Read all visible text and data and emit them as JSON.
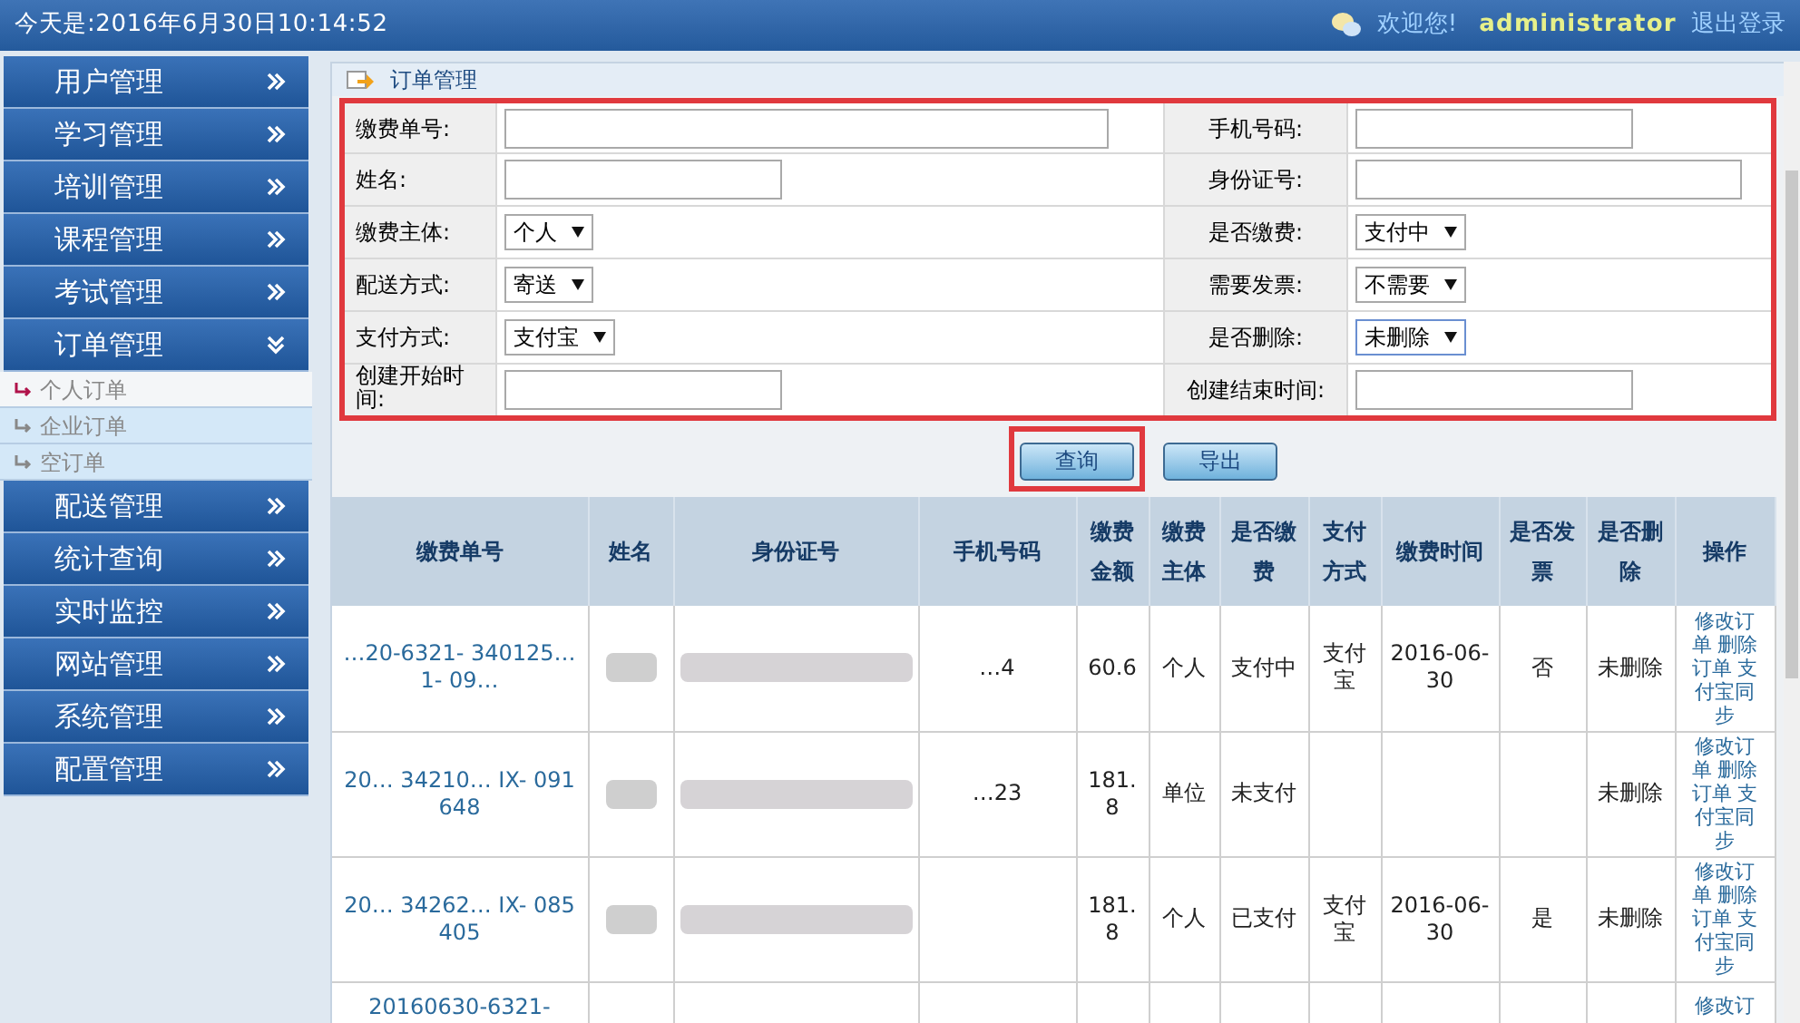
{
  "header": {
    "datetime": "今天是:2016年6月30日10:14:52",
    "welcome": "欢迎您!",
    "username": "administrator",
    "logout": "退出登录"
  },
  "sidebar": {
    "items": [
      {
        "label": "用户管理",
        "expanded": false
      },
      {
        "label": "学习管理",
        "expanded": false
      },
      {
        "label": "培训管理",
        "expanded": false
      },
      {
        "label": "课程管理",
        "expanded": false
      },
      {
        "label": "考试管理",
        "expanded": false
      },
      {
        "label": "订单管理",
        "expanded": true,
        "children": [
          {
            "label": "个人订单",
            "selected": true
          },
          {
            "label": "企业订单",
            "selected": false
          },
          {
            "label": "空订单",
            "selected": false
          }
        ]
      },
      {
        "label": "配送管理",
        "expanded": false
      },
      {
        "label": "统计查询",
        "expanded": false
      },
      {
        "label": "实时监控",
        "expanded": false
      },
      {
        "label": "网站管理",
        "expanded": false
      },
      {
        "label": "系统管理",
        "expanded": false
      },
      {
        "label": "配置管理",
        "expanded": false
      }
    ]
  },
  "panel": {
    "title": "订单管理"
  },
  "form": {
    "rows": [
      [
        {
          "label": "缴费单号:",
          "kind": "text",
          "wide": true
        },
        {
          "label": "手机号码:",
          "kind": "text",
          "wide": false
        }
      ],
      [
        {
          "label": "姓名:",
          "kind": "text",
          "wide": false
        },
        {
          "label": "身份证号:",
          "kind": "text",
          "wide": true
        }
      ],
      [
        {
          "label": "缴费主体:",
          "kind": "select",
          "value": "个人"
        },
        {
          "label": "是否缴费:",
          "kind": "select",
          "value": "支付中"
        }
      ],
      [
        {
          "label": "配送方式:",
          "kind": "select",
          "value": "寄送"
        },
        {
          "label": "需要发票:",
          "kind": "select",
          "value": "不需要"
        }
      ],
      [
        {
          "label": "支付方式:",
          "kind": "select",
          "value": "支付宝"
        },
        {
          "label": "是否删除:",
          "kind": "select",
          "value": "未删除",
          "focused": true
        }
      ],
      [
        {
          "label": "创建开始时间:",
          "kind": "text",
          "wide": false
        },
        {
          "label": "创建结束时间:",
          "kind": "text",
          "wide": false
        }
      ]
    ]
  },
  "buttons": [
    {
      "label": "查询",
      "highlighted": true
    },
    {
      "label": "导出",
      "highlighted": false
    }
  ],
  "table": {
    "columns": [
      "缴费单号",
      "姓名",
      "身份证号",
      "手机号码",
      "缴费金额",
      "缴费主体",
      "是否缴费",
      "支付方式",
      "缴费时间",
      "是否发票",
      "是否删除",
      "操作"
    ],
    "rows": [
      {
        "order_no": "…20-6321- 340125… 1- 09…",
        "name_redacted": true,
        "id_redacted": true,
        "phone": "…4",
        "amount": "60.6",
        "payer": "个人",
        "paid": "支付中",
        "method": "支付宝",
        "time": "2016-06-30",
        "invoice": "否",
        "deleted": "未删除",
        "action": "修改订单 删除订单 支付宝同步"
      },
      {
        "order_no": "20… 34210… IX- 091648",
        "name_redacted": true,
        "id_redacted": true,
        "phone": "…23",
        "amount": "181.8",
        "payer": "单位",
        "paid": "未支付",
        "method": "",
        "time": "",
        "invoice": "",
        "deleted": "未删除",
        "action": "修改订单 删除订单 支付宝同步"
      },
      {
        "order_no": "20… 34262… IX- 085405",
        "name_redacted": true,
        "id_redacted": true,
        "phone": "",
        "amount": "181.8",
        "payer": "个人",
        "paid": "已支付",
        "method": "支付宝",
        "time": "2016-06-30",
        "invoice": "是",
        "deleted": "未删除",
        "action": "修改订单 删除订单 支付宝同步"
      },
      {
        "order_no": "20160630-6321-",
        "phone": "",
        "amount": "",
        "payer": "",
        "paid": "",
        "method": "",
        "time": "",
        "invoice": "",
        "deleted": "",
        "action": "修改订"
      }
    ]
  }
}
